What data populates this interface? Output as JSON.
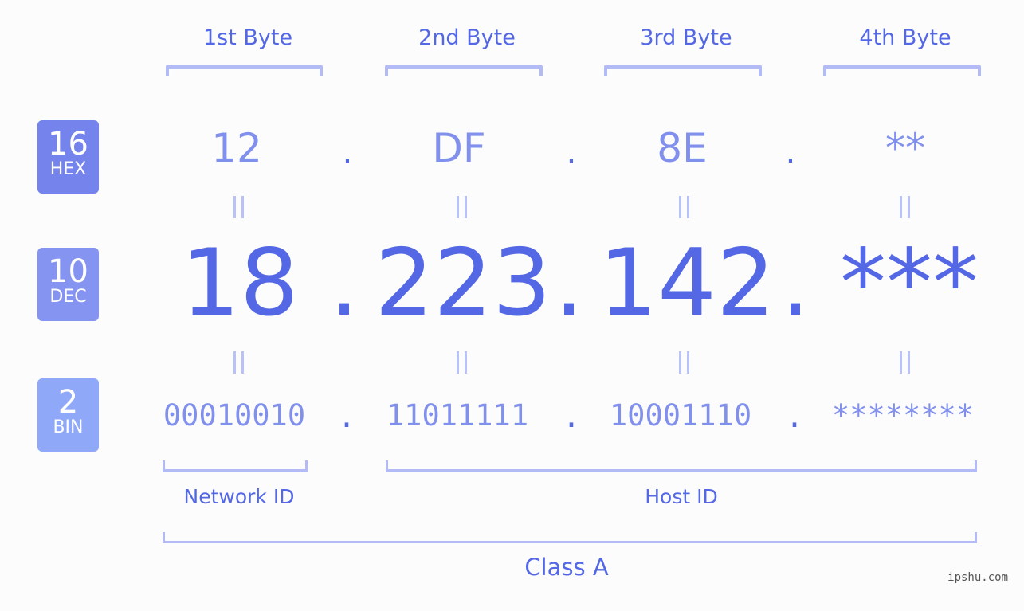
{
  "bytes": [
    {
      "label": "1st Byte",
      "hex": "12",
      "dec": "18",
      "bin": "00010010"
    },
    {
      "label": "2nd Byte",
      "hex": "DF",
      "dec": "223",
      "bin": "11011111"
    },
    {
      "label": "3rd Byte",
      "hex": "8E",
      "dec": "142",
      "bin": "10001110"
    },
    {
      "label": "4th Byte",
      "hex": "**",
      "dec": "***",
      "bin": "********"
    }
  ],
  "separator": ".",
  "equals": "=",
  "badges": {
    "hex": {
      "num": "16",
      "label": "HEX",
      "color": "#7584ec"
    },
    "dec": {
      "num": "10",
      "label": "DEC",
      "color": "#8694f1"
    },
    "bin": {
      "num": "2",
      "label": "BIN",
      "color": "#8fa8f8"
    }
  },
  "segments": {
    "network_id": "Network ID",
    "host_id": "Host ID",
    "class": "Class A"
  },
  "watermark": "ipshu.com",
  "colors": {
    "accent": "#5468e6",
    "light_accent": "#8290ed",
    "bracket": "#b2bbf6"
  }
}
